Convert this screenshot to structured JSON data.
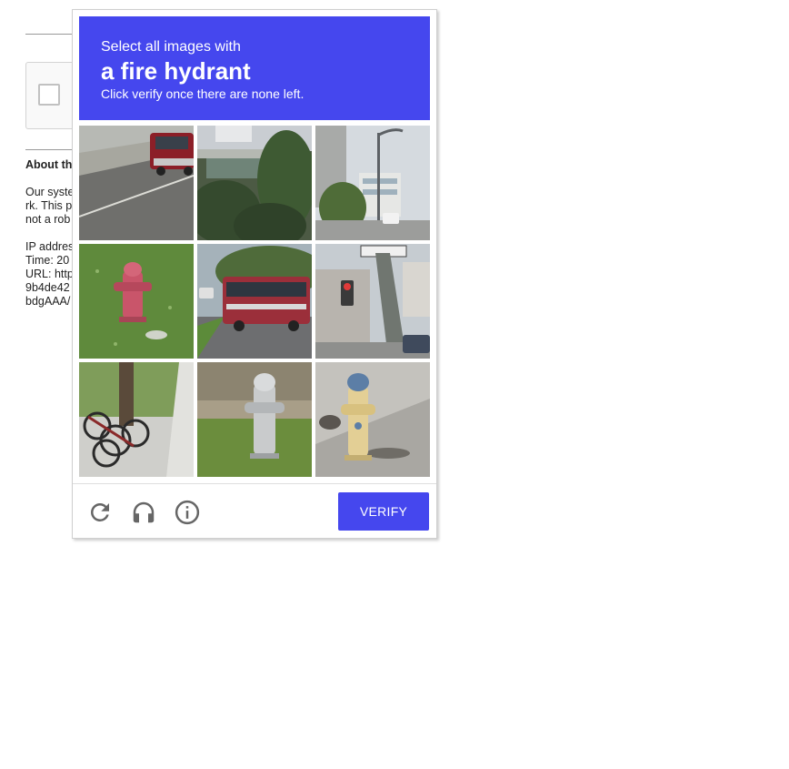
{
  "background_page": {
    "about_heading": "About th",
    "paragraph_lines": [
      "Our syste",
      "rk. This p",
      "not a rob"
    ],
    "info_lines": [
      "IP addres",
      "Time: 20",
      "URL: http",
      "9b4de42",
      "bdgAAA/"
    ]
  },
  "challenge": {
    "instruction_prefix": "Select all images with",
    "target_object": "a fire hydrant",
    "instruction_suffix": "Click verify once there are none left.",
    "accent_color": "#4547ee",
    "tiles": [
      {
        "subject": "pickup truck on highway"
      },
      {
        "subject": "overpass and trees"
      },
      {
        "subject": "street lamp and buildings"
      },
      {
        "subject": "red fire hydrant on grass"
      },
      {
        "subject": "bus on road"
      },
      {
        "subject": "traffic light and street sign"
      },
      {
        "subject": "bicycles parked by tree"
      },
      {
        "subject": "silver fire hydrant on grass"
      },
      {
        "subject": "yellow fire hydrant on sidewalk"
      }
    ],
    "controls": {
      "reload_icon": "reload-icon",
      "audio_icon": "headphones-icon",
      "info_icon": "info-icon",
      "verify_label": "VERIFY"
    }
  }
}
